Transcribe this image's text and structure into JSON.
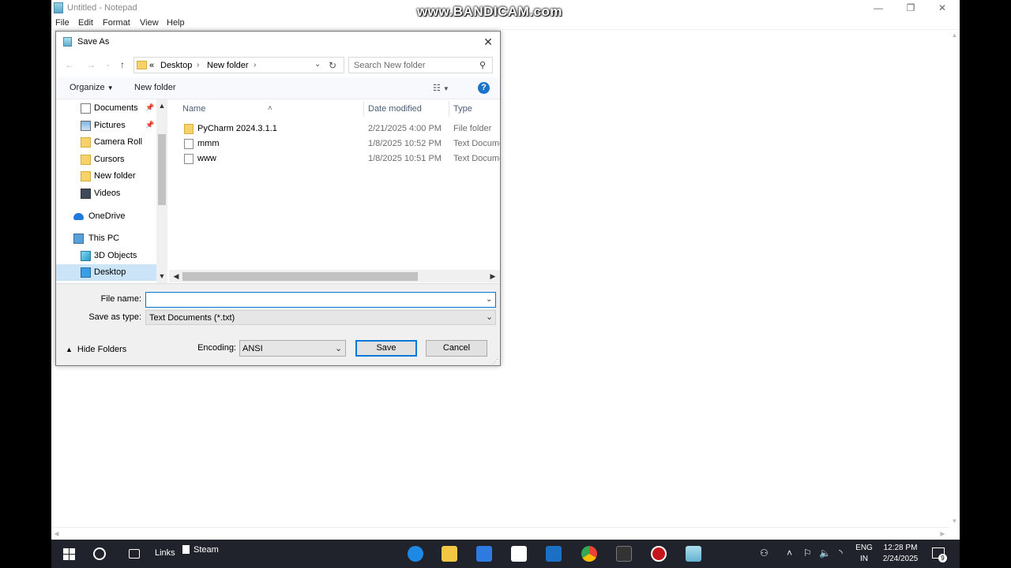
{
  "notepad": {
    "title": "Untitled - Notepad",
    "menu": [
      "File",
      "Edit",
      "Format",
      "View",
      "Help"
    ],
    "controls": {
      "minimize": "—",
      "maximize": "❐",
      "close": "✕"
    }
  },
  "watermark": "www.BANDICAM.com",
  "dialog": {
    "title": "Save As",
    "close": "✕",
    "address": {
      "overflow": "«",
      "crumbs": [
        "Desktop",
        "New folder"
      ]
    },
    "search_placeholder": "Search New folder",
    "toolbar": {
      "organize": "Organize",
      "new_folder": "New folder"
    },
    "nav_items": [
      {
        "label": "Documents",
        "icon": "documents-icon",
        "pinned": true
      },
      {
        "label": "Pictures",
        "icon": "pictures-icon",
        "pinned": true
      },
      {
        "label": "Camera Roll",
        "icon": "folder-icon",
        "pinned": false
      },
      {
        "label": "Cursors",
        "icon": "folder-icon",
        "pinned": false
      },
      {
        "label": "New folder",
        "icon": "folder-icon",
        "pinned": false
      },
      {
        "label": "Videos",
        "icon": "videos-icon",
        "pinned": false
      },
      {
        "label": "OneDrive",
        "icon": "onedrive-icon",
        "pinned": false
      },
      {
        "label": "This PC",
        "icon": "pc-icon",
        "pinned": false
      },
      {
        "label": "3D Objects",
        "icon": "3d-objects-icon",
        "pinned": false
      },
      {
        "label": "Desktop",
        "icon": "desktop-icon",
        "pinned": false,
        "selected": true
      }
    ],
    "columns": {
      "name": "Name",
      "date": "Date modified",
      "type": "Type"
    },
    "files": [
      {
        "name": "PyCharm 2024.3.1.1",
        "date": "2/21/2025 4:00 PM",
        "type": "File folder",
        "icon": "folder-icon"
      },
      {
        "name": "mmm",
        "date": "1/8/2025 10:52 PM",
        "type": "Text Document",
        "icon": "text-file-icon"
      },
      {
        "name": "www",
        "date": "1/8/2025 10:51 PM",
        "type": "Text Document",
        "icon": "text-file-icon"
      }
    ],
    "file_name_label": "File name:",
    "file_name_value": "",
    "save_as_type_label": "Save as type:",
    "save_as_type_value": "Text Documents (*.txt)",
    "hide_folders": "Hide Folders",
    "encoding_label": "Encoding:",
    "encoding_value": "ANSI",
    "save_label": "Save",
    "cancel_label": "Cancel"
  },
  "taskbar": {
    "links": "Links",
    "steam": "Steam",
    "lang": [
      "ENG",
      "IN"
    ],
    "time": "12:28 PM",
    "date": "2/24/2025",
    "notifications": "9"
  }
}
